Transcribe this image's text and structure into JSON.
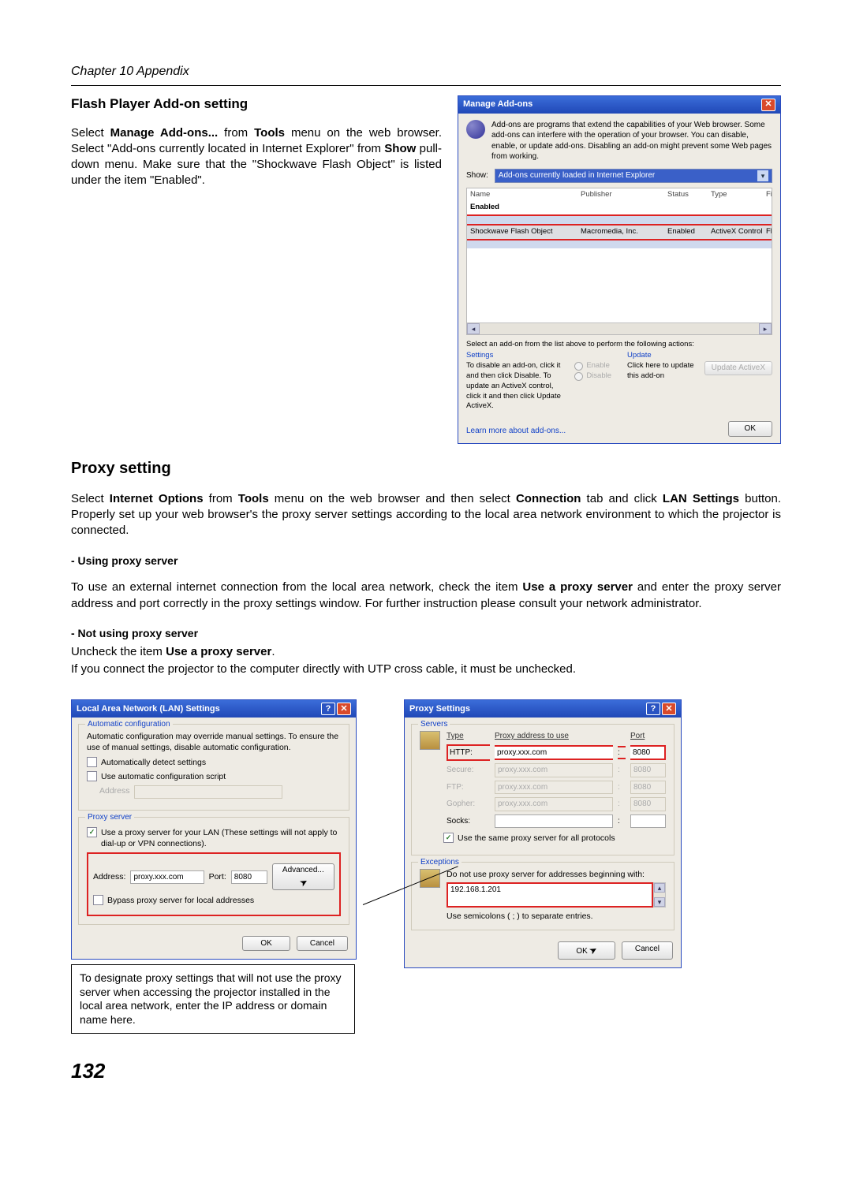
{
  "chapter": "Chapter 10 Appendix",
  "flash": {
    "heading": "Flash Player Add-on setting",
    "para_parts": [
      "Select ",
      "Manage Add-ons...",
      " from ",
      "Tools",
      " menu on the web browser. Select \"Add-ons currently located in Internet Explorer\" from ",
      "Show",
      " pull-down menu. Make sure that the \"Shockwave Flash Object\" is listed under the item \"Enabled\"."
    ]
  },
  "manage_addons": {
    "title": "Manage Add-ons",
    "desc": "Add-ons are programs that extend the capabilities of your Web browser. Some add-ons can interfere with the operation of your browser. You can disable, enable, or update add-ons. Disabling an add-on might prevent some Web pages from working.",
    "show_label": "Show:",
    "show_value": "Add-ons currently loaded in Internet Explorer",
    "columns": {
      "name": "Name",
      "publisher": "Publisher",
      "status": "Status",
      "type": "Type",
      "file": "File"
    },
    "group": "Enabled",
    "row": {
      "name": "Shockwave Flash Object",
      "publisher": "Macromedia, Inc.",
      "status": "Enabled",
      "type": "ActiveX Control",
      "file": "Flash.ocx"
    },
    "select_text": "Select an add-on from the list above to perform the following actions:",
    "settings_head": "Settings",
    "settings_text": "To disable an add-on, click it and then click Disable. To update an ActiveX control, click it and then click Update ActiveX.",
    "enable": "Enable",
    "disable": "Disable",
    "update_head": "Update",
    "update_text": "Click here to update this add-on",
    "update_btn": "Update ActiveX",
    "learn": "Learn more about add-ons...",
    "ok": "OK"
  },
  "proxy": {
    "heading": "Proxy setting",
    "intro_parts": [
      "Select ",
      "Internet Options",
      " from ",
      "Tools",
      " menu on the web browser and then select ",
      "Connection",
      " tab and click ",
      "LAN Settings",
      " button. Properly set up your web browser's the proxy server settings according to the local area network environment to which the projector is connected."
    ],
    "using_head": "- Using proxy server",
    "using_parts": [
      "To use an external internet connection from the local area network, check the item ",
      "Use a proxy server",
      " and enter the proxy server address and port correctly in the proxy settings window. For further instruction please consult your network administrator."
    ],
    "notusing_head": "- Not using proxy server",
    "notusing_parts": [
      "Uncheck the item ",
      "Use a proxy server",
      "."
    ],
    "notusing_line2": "If you connect the projector to the computer directly with UTP cross cable, it must be unchecked."
  },
  "lan_dialog": {
    "title": "Local Area Network (LAN) Settings",
    "auto_legend": "Automatic configuration",
    "auto_text": "Automatic configuration may override manual settings. To ensure the use of manual settings, disable automatic configuration.",
    "auto_detect": "Automatically detect settings",
    "auto_script": "Use automatic configuration script",
    "address_label": "Address",
    "proxy_legend": "Proxy server",
    "use_proxy": "Use a proxy server for your LAN (These settings will not apply to dial-up or VPN connections).",
    "address2_label": "Address:",
    "address2_value": "proxy.xxx.com",
    "port_label": "Port:",
    "port_value": "8080",
    "advanced": "Advanced...",
    "bypass": "Bypass proxy server for local addresses",
    "ok": "OK",
    "cancel": "Cancel"
  },
  "proxy_dialog": {
    "title": "Proxy Settings",
    "servers_legend": "Servers",
    "col_type": "Type",
    "col_addr": "Proxy address to use",
    "col_port": "Port",
    "rows": {
      "http": {
        "label": "HTTP:",
        "addr": "proxy.xxx.com",
        "port": "8080"
      },
      "secure": {
        "label": "Secure:",
        "addr": "proxy.xxx.com",
        "port": "8080"
      },
      "ftp": {
        "label": "FTP:",
        "addr": "proxy.xxx.com",
        "port": "8080"
      },
      "gopher": {
        "label": "Gopher:",
        "addr": "proxy.xxx.com",
        "port": "8080"
      },
      "socks": {
        "label": "Socks:",
        "addr": "",
        "port": ""
      }
    },
    "same": "Use the same proxy server for all protocols",
    "exceptions_legend": "Exceptions",
    "exceptions_text": "Do not use proxy server for addresses beginning with:",
    "exceptions_value": "192.168.1.201",
    "semicolons": "Use semicolons ( ; ) to separate entries.",
    "ok": "OK",
    "cancel": "Cancel"
  },
  "caption": "To designate proxy settings that will not use the proxy server when accessing the projector installed in the local area network, enter the IP address or domain name here.",
  "page": "132"
}
